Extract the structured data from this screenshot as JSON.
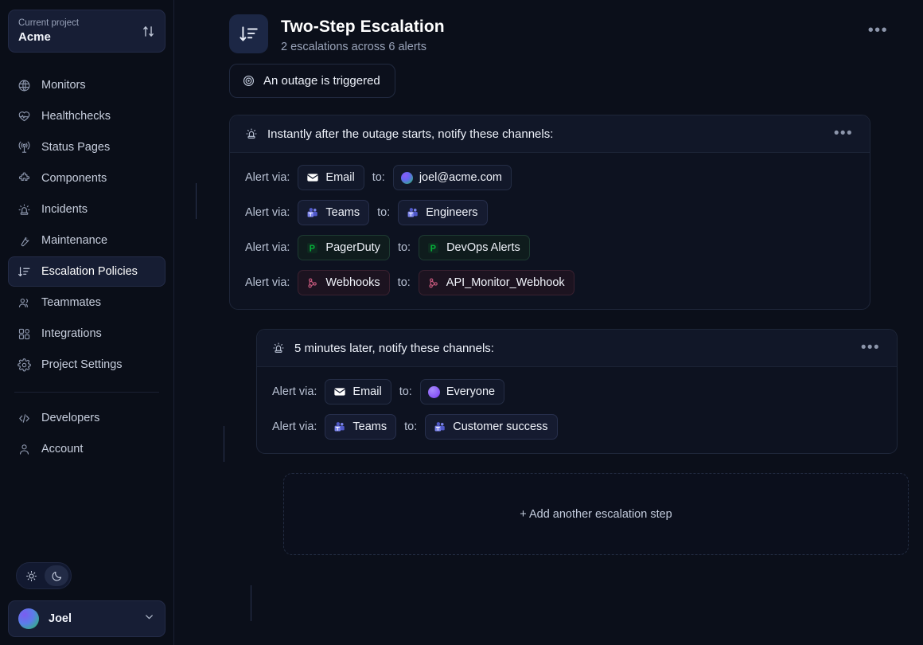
{
  "sidebar": {
    "project": {
      "label": "Current project",
      "name": "Acme",
      "switch_icon": "switch-vertical-icon"
    },
    "items": [
      {
        "label": "Monitors",
        "icon": "monitor-globe-icon",
        "active": false
      },
      {
        "label": "Healthchecks",
        "icon": "heart-pulse-icon",
        "active": false
      },
      {
        "label": "Status Pages",
        "icon": "broadcast-icon",
        "active": false
      },
      {
        "label": "Components",
        "icon": "puzzle-icon",
        "active": false
      },
      {
        "label": "Incidents",
        "icon": "siren-icon",
        "active": false
      },
      {
        "label": "Maintenance",
        "icon": "wrench-icon",
        "active": false
      },
      {
        "label": "Escalation Policies",
        "icon": "sort-descending-icon",
        "active": true
      },
      {
        "label": "Teammates",
        "icon": "users-icon",
        "active": false
      },
      {
        "label": "Integrations",
        "icon": "grid-plus-icon",
        "active": false
      },
      {
        "label": "Project Settings",
        "icon": "gear-icon",
        "active": false
      }
    ],
    "secondary_items": [
      {
        "label": "Developers",
        "icon": "code-brackets-icon"
      },
      {
        "label": "Account",
        "icon": "person-icon"
      }
    ],
    "theme": {
      "light_icon": "sun-icon",
      "dark_icon": "moon-icon",
      "selected": "dark"
    },
    "user": {
      "name": "Joel",
      "avatar": "gradient-avatar",
      "chevron": "chevron-down-icon"
    }
  },
  "header": {
    "icon": "sort-descending-icon",
    "title": "Two-Step Escalation",
    "subtitle": "2 escalations across 6 alerts",
    "menu_label": "•••"
  },
  "trigger": {
    "icon": "target-icon",
    "label": "An outage is triggered"
  },
  "steps": [
    {
      "icon": "siren-icon",
      "title": "Instantly after the outage starts, notify these channels:",
      "menu_label": "•••",
      "rules": [
        {
          "via_label": "Alert via:",
          "channel": {
            "name": "Email",
            "icon": "envelope-icon",
            "type": "email"
          },
          "to_label": "to:",
          "target": {
            "name": "joel@acme.com",
            "icon": "gradient-avatar",
            "type": "email"
          }
        },
        {
          "via_label": "Alert via:",
          "channel": {
            "name": "Teams",
            "icon": "microsoft-teams-icon",
            "type": "teams"
          },
          "to_label": "to:",
          "target": {
            "name": "Engineers",
            "icon": "microsoft-teams-icon",
            "type": "teams"
          }
        },
        {
          "via_label": "Alert via:",
          "channel": {
            "name": "PagerDuty",
            "icon": "pagerduty-icon",
            "type": "pagerduty"
          },
          "to_label": "to:",
          "target": {
            "name": "DevOps Alerts",
            "icon": "pagerduty-icon",
            "type": "pagerduty"
          }
        },
        {
          "via_label": "Alert via:",
          "channel": {
            "name": "Webhooks",
            "icon": "webhook-icon",
            "type": "webhooks"
          },
          "to_label": "to:",
          "target": {
            "name": "API_Monitor_Webhook",
            "icon": "webhook-icon",
            "type": "webhooks"
          }
        }
      ]
    },
    {
      "icon": "siren-icon",
      "title": "5 minutes later, notify these channels:",
      "menu_label": "•••",
      "rules": [
        {
          "via_label": "Alert via:",
          "channel": {
            "name": "Email",
            "icon": "envelope-icon",
            "type": "email"
          },
          "to_label": "to:",
          "target": {
            "name": "Everyone",
            "icon": "purple-avatar",
            "type": "everyone"
          }
        },
        {
          "via_label": "Alert via:",
          "channel": {
            "name": "Teams",
            "icon": "microsoft-teams-icon",
            "type": "teams"
          },
          "to_label": "to:",
          "target": {
            "name": "Customer success",
            "icon": "microsoft-teams-icon",
            "type": "teams"
          }
        }
      ]
    }
  ],
  "add_step": {
    "label": "+ Add another escalation step"
  },
  "colors": {
    "background": "#0b0f1a",
    "sidebar_bg": "#0a0e18",
    "card_bg": "#0d1220",
    "card_header_bg": "#111728",
    "border": "#1e2639",
    "accent_active": "#161d33",
    "text_primary": "#eef2fa",
    "text_secondary": "#9aa4ba",
    "pagerduty_green": "#22c55e",
    "teams_purple": "#6d78d6",
    "webhook_pink": "#c2577a"
  }
}
